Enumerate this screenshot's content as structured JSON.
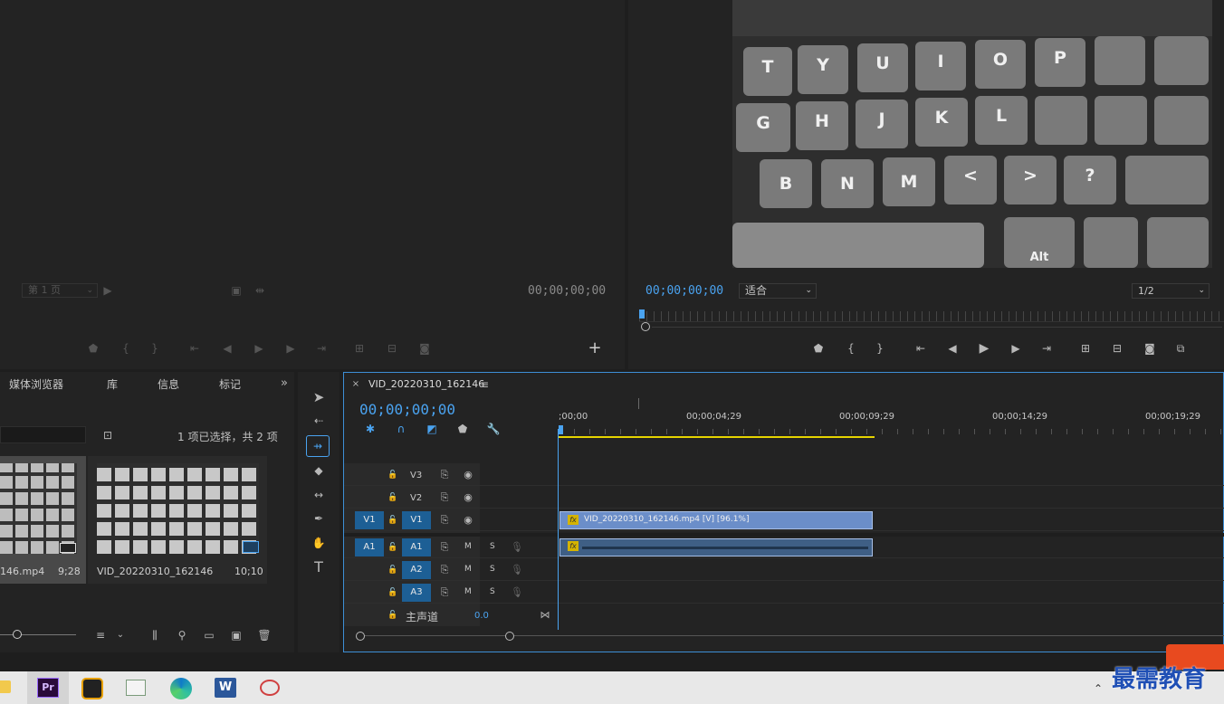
{
  "source_monitor": {
    "page_select": "第 1 页",
    "timecode": "00;00;00;00"
  },
  "program_monitor": {
    "timecode": "00;00;00;00",
    "fit": "适合",
    "resolution": "1/2"
  },
  "project_panel": {
    "tabs": [
      "媒体浏览器",
      "库",
      "信息",
      "标记"
    ],
    "selection_status": "1 项已选择，共 2 项",
    "items": [
      {
        "name": "146.mp4",
        "duration": "9;28"
      },
      {
        "name": "VID_20220310_162146",
        "duration": "10;10"
      }
    ]
  },
  "timeline": {
    "sequence_name": "VID_20220310_162146",
    "timecode": "00;00;00;00",
    "ruler": [
      ";00;00",
      "00;00;04;29",
      "00;00;09;29",
      "00;00;14;29",
      "00;00;19;29"
    ],
    "video_tracks": [
      {
        "label": "V3",
        "source": ""
      },
      {
        "label": "V2",
        "source": ""
      },
      {
        "label": "V1",
        "source": "V1"
      }
    ],
    "audio_tracks": [
      {
        "label": "A1",
        "source": "A1",
        "m": "M",
        "s": "S"
      },
      {
        "label": "A2",
        "source": "",
        "m": "M",
        "s": "S"
      },
      {
        "label": "A3",
        "source": "",
        "m": "M",
        "s": "S"
      }
    ],
    "master": {
      "label": "主声道",
      "value": "0.0"
    },
    "video_clip": "VID_20220310_162146.mp4 [V] [96.1%]",
    "fx_badge": "fx"
  },
  "taskbar": {
    "watermark": "最需教育",
    "apps": [
      "file-explorer",
      "premiere-pro",
      "app-g",
      "app-window",
      "edge",
      "word",
      "app-feather"
    ],
    "premiere_label": "Pr",
    "word_label": "W"
  },
  "keyboard": {
    "row1": [
      "T",
      "Y",
      "U",
      "I",
      "O",
      "P"
    ],
    "row2": [
      "G",
      "H",
      "J",
      "K",
      "L"
    ],
    "row3": [
      "B",
      "N",
      "M",
      "<",
      ">",
      "?"
    ],
    "alt": "Alt"
  },
  "colors": {
    "accent": "#4aa3f0",
    "track_blue": "#1d5f95",
    "clip_video": "#6b8ec9",
    "work_area": "#e6d400"
  }
}
